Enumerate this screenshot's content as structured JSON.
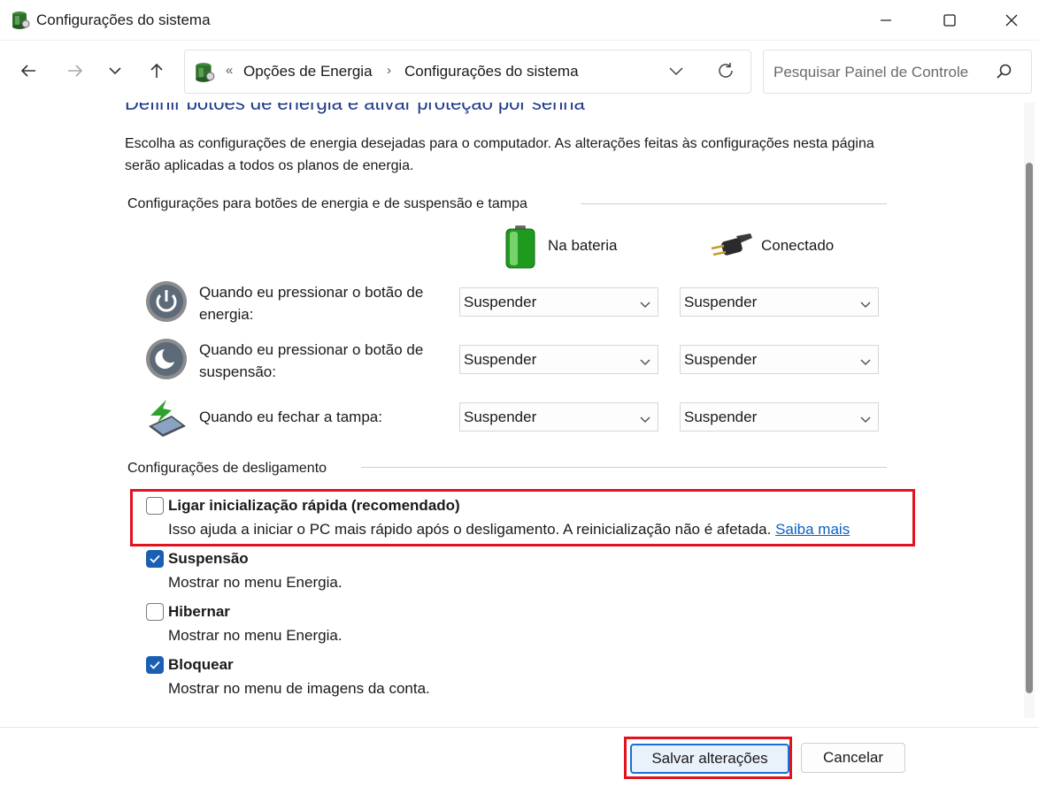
{
  "window": {
    "title": "Configurações do sistema"
  },
  "address": {
    "overflow": "«",
    "crumbs": [
      "Opções de Energia",
      "Configurações do sistema"
    ]
  },
  "search": {
    "placeholder": "Pesquisar Painel de Controle"
  },
  "page": {
    "heading": "Definir botões de energia e ativar proteção por senha",
    "description": "Escolha as configurações de energia desejadas para o computador. As alterações feitas às configurações nesta página serão aplicadas a todos os planos de energia."
  },
  "power_buttons": {
    "group_label": "Configurações para botões de energia e de suspensão e tampa",
    "columns": [
      "Na bateria",
      "Conectado"
    ],
    "rows": [
      {
        "label": "Quando eu pressionar o botão de energia:",
        "battery": "Suspender",
        "plugged": "Suspender",
        "icon": "power-button-icon"
      },
      {
        "label": "Quando eu pressionar o botão de suspensão:",
        "battery": "Suspender",
        "plugged": "Suspender",
        "icon": "sleep-button-icon"
      },
      {
        "label": "Quando eu fechar a tampa:",
        "battery": "Suspender",
        "plugged": "Suspender",
        "icon": "laptop-lid-icon"
      }
    ]
  },
  "shutdown": {
    "group_label": "Configurações de desligamento",
    "options": [
      {
        "title": "Ligar inicialização rápida (recomendado)",
        "desc": "Isso ajuda a iniciar o PC mais rápido após o desligamento. A reinicialização não é afetada.",
        "link": "Saiba mais",
        "checked": false
      },
      {
        "title": "Suspensão",
        "desc": "Mostrar no menu Energia.",
        "checked": true
      },
      {
        "title": "Hibernar",
        "desc": "Mostrar no menu Energia.",
        "checked": false
      },
      {
        "title": "Bloquear",
        "desc": "Mostrar no menu de imagens da conta.",
        "checked": true
      }
    ]
  },
  "footer": {
    "save_label": "Salvar alterações",
    "cancel_label": "Cancelar"
  },
  "colors": {
    "accent": "#1a5fb4",
    "heading": "#1e3a8a",
    "highlight": "#e0131f",
    "link": "#0b61c4"
  }
}
